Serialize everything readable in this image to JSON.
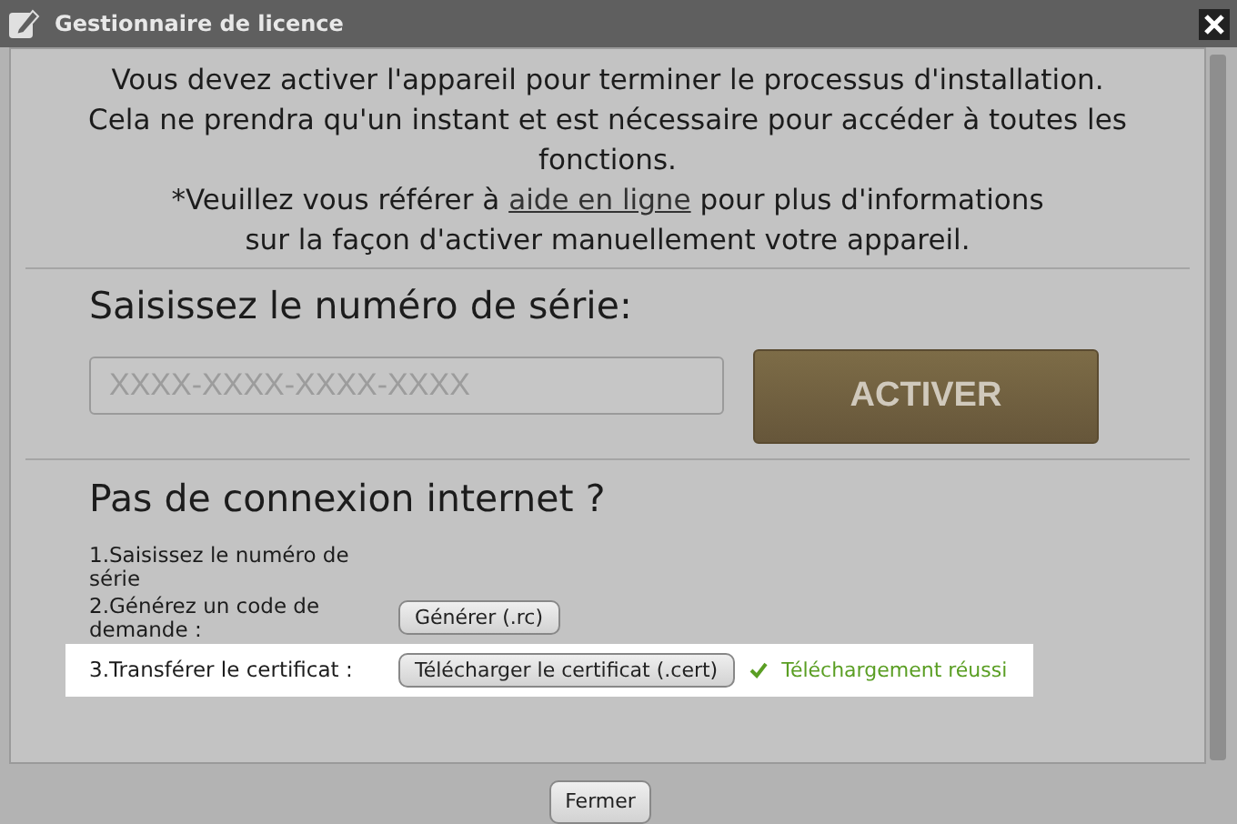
{
  "window": {
    "title": "Gestionnaire de licence"
  },
  "intro": [
    "Vous devez activer l'appareil pour terminer le processus d'installation.",
    "Cela ne prendra qu'un instant et est nécessaire pour accéder à toutes les fonctions."
  ],
  "help": {
    "before": "*Veuillez vous référer à ",
    "link": "aide en ligne",
    "after": " pour plus d'informations sur la façon d'activer manuellement votre appareil."
  },
  "serial": {
    "heading": "Saisissez le numéro de série:",
    "placeholder": "XXXX-XXXX-XXXX-XXXX",
    "button": "ACTIVER"
  },
  "offline": {
    "heading": "Pas de connexion internet ?",
    "steps": [
      {
        "label": "1.Saisissez le numéro de série",
        "highlighted": false
      },
      {
        "label": "2.Générez un code de demande :",
        "button": "Générer (.rc)",
        "highlighted": false
      },
      {
        "label": "3.Transférer le certificat :",
        "button": "Télécharger le certificat (.cert)",
        "status": "Téléchargement réussi",
        "highlighted": true
      }
    ]
  },
  "footer": {
    "button": "Fermer"
  }
}
